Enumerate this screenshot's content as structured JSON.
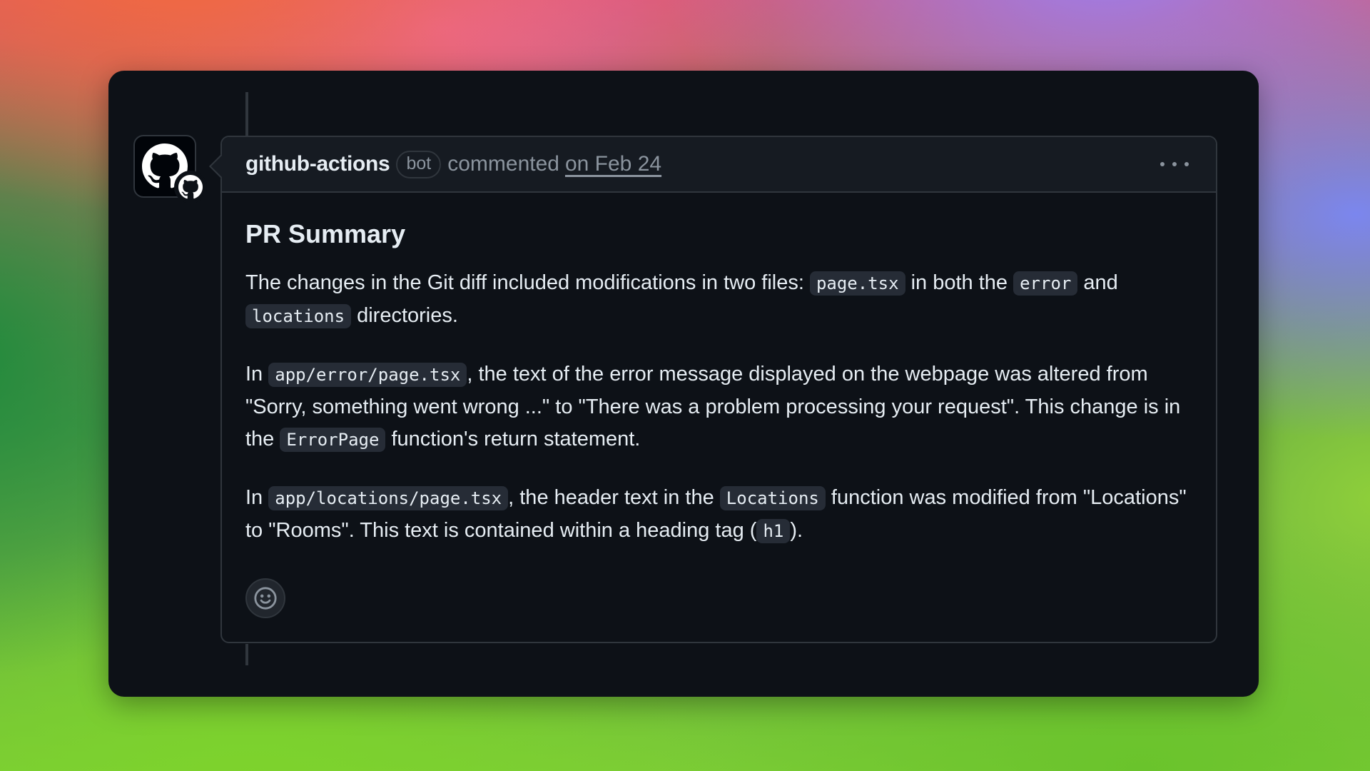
{
  "comment": {
    "author": "github-actions",
    "badge": "bot",
    "action": "commented",
    "date": "on Feb 24",
    "menu_icon": "kebab-horizontal-icon",
    "avatar_icon": "github-mark-icon",
    "reaction_icon": "smiley-icon"
  },
  "body": {
    "heading": "PR Summary",
    "p1": {
      "t1": "The changes in the Git diff included modifications in two files: ",
      "c1": "page.tsx",
      "t2": " in both the ",
      "c2": "error",
      "t3": " and ",
      "c3": "locations",
      "t4": " directories."
    },
    "p2": {
      "t1": "In ",
      "c1": "app/error/page.tsx",
      "t2": ", the text of the error message displayed on the webpage was altered from \"Sorry, something went wrong ...\" to \"There was a problem processing your request\". This change is in the ",
      "c2": "ErrorPage",
      "t3": " function's return statement."
    },
    "p3": {
      "t1": "In ",
      "c1": "app/locations/page.tsx",
      "t2": ", the header text in the ",
      "c2": "Locations",
      "t3": " function was modified from \"Locations\" to \"Rooms\". This text is contained within a heading tag (",
      "c3": "h1",
      "t4": ")."
    }
  },
  "colors": {
    "panel_bg": "#0d1117",
    "header_bg": "#161b22",
    "border": "#30363d",
    "text": "#e6edf3",
    "muted": "#8b949e"
  }
}
